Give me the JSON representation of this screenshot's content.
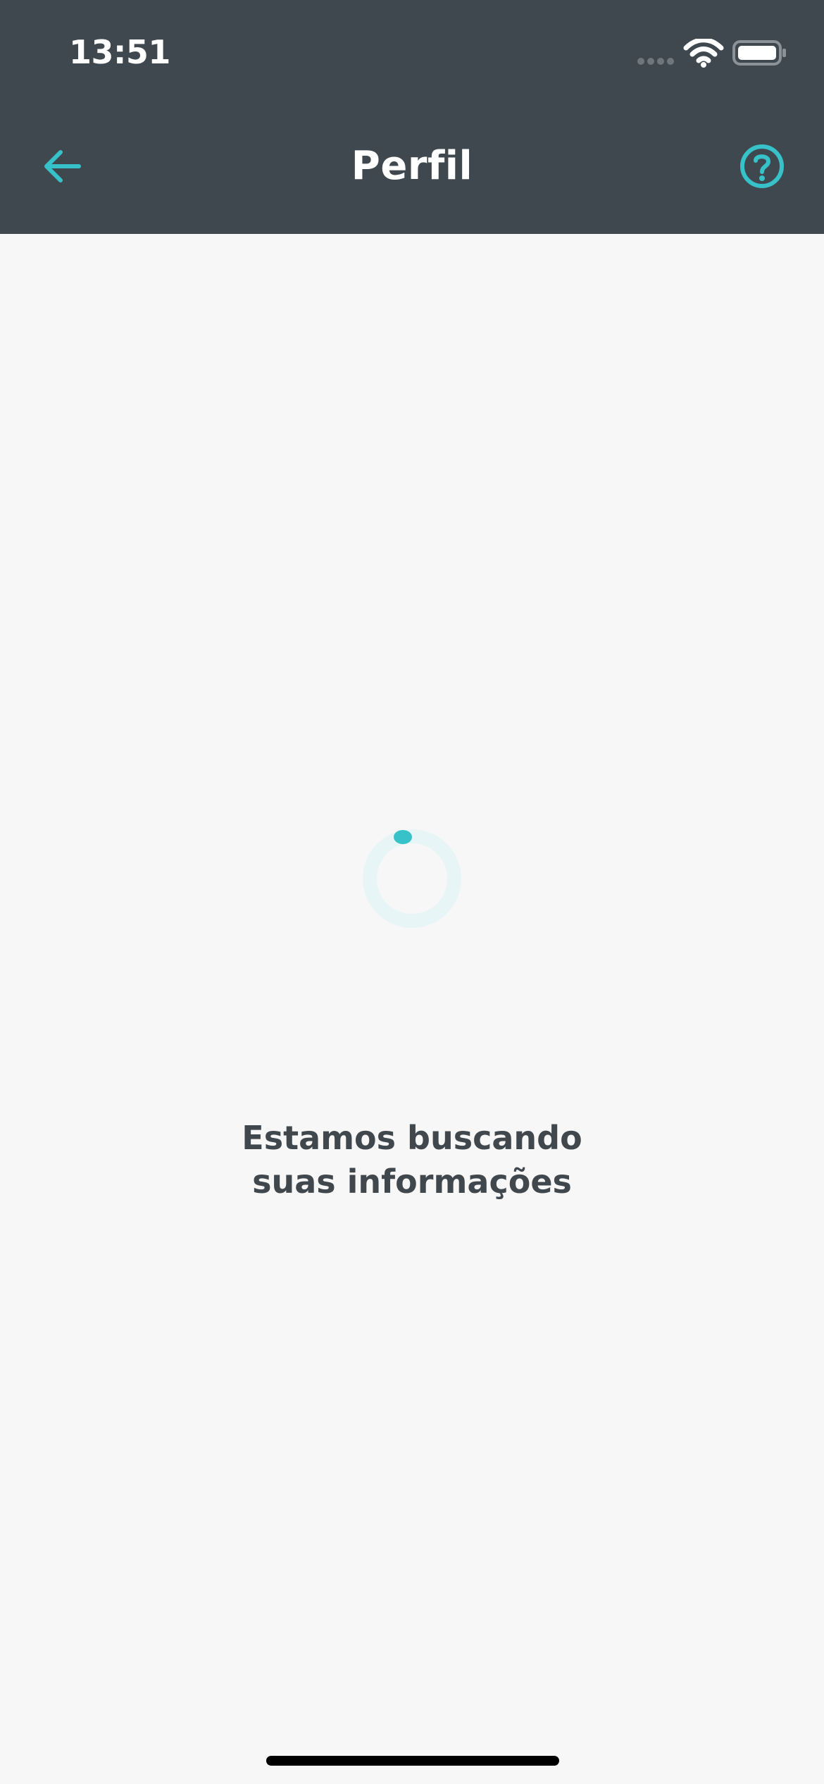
{
  "status_bar": {
    "time": "13:51"
  },
  "header": {
    "title": "Perfil",
    "back_icon": "arrow-left-icon",
    "help_icon": "help-circle-icon"
  },
  "loading": {
    "message_line_1": "Estamos buscando",
    "message_line_2": "suas informações"
  },
  "colors": {
    "header_background": "#3f484f",
    "content_background": "#f7f7f7",
    "accent": "#37c2c9",
    "text_primary": "#40474d",
    "spinner_track": "#e8f5f6"
  }
}
